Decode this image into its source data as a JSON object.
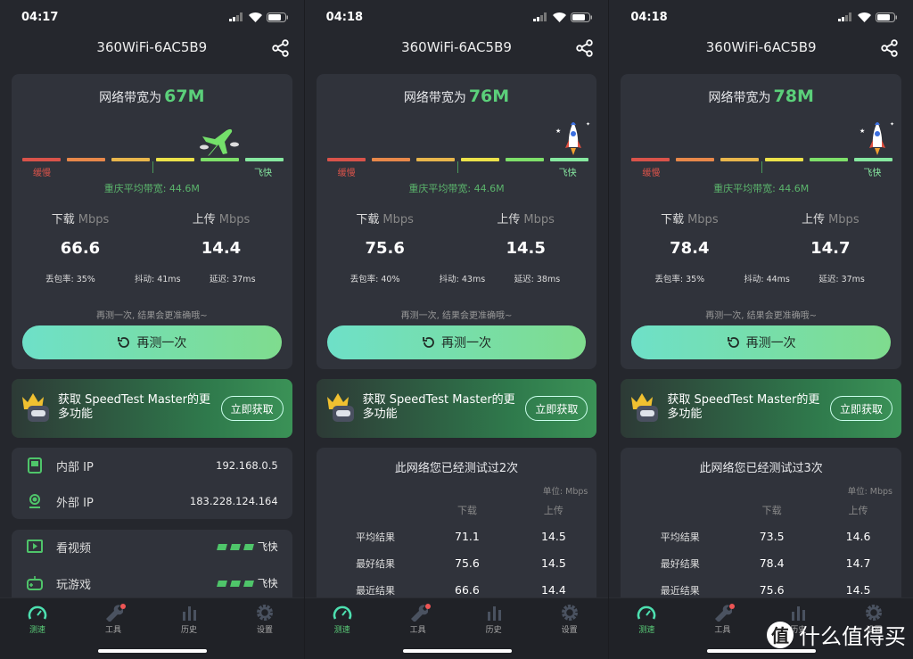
{
  "colors": {
    "accent": "#5bd07a",
    "segments": [
      "#d9534a",
      "#e8884a",
      "#e8b64c",
      "#ece24a",
      "#7ee06a",
      "#86e8a0"
    ]
  },
  "phones": [
    {
      "time": "04:17",
      "title": "360WiFi-6AC5B9",
      "bandwidth_label": "网络带宽为",
      "bandwidth": "67M",
      "gauge_icon": "airplane-icon",
      "gauge_segment": 5,
      "slow": "缓慢",
      "fast": "飞快",
      "avg": "重庆平均带宽: 44.6M",
      "download_label": "下载",
      "upload_label": "上传",
      "unit": "Mbps",
      "download": "66.6",
      "upload": "14.4",
      "loss": "丢包率: 35%",
      "jitter": "抖动: 41ms",
      "latency": "延迟: 37ms",
      "hint": "再测一次, 结果会更准确哦~",
      "retest": "再测一次",
      "promo": "获取 SpeedTest Master的更多功能",
      "promo_btn": "立即获取",
      "ip": [
        {
          "label": "内部 IP",
          "value": "192.168.0.5"
        },
        {
          "label": "外部 IP",
          "value": "183.228.124.164"
        }
      ],
      "apps": [
        {
          "label": "看视频",
          "value": "飞快",
          "level": 3
        },
        {
          "label": "玩游戏",
          "value": "飞快",
          "level": 3
        }
      ]
    },
    {
      "time": "04:18",
      "title": "360WiFi-6AC5B9",
      "bandwidth_label": "网络带宽为",
      "bandwidth": "76M",
      "gauge_icon": "rocket-icon",
      "gauge_segment": 6,
      "slow": "缓慢",
      "fast": "飞快",
      "avg": "重庆平均带宽: 44.6M",
      "download_label": "下载",
      "upload_label": "上传",
      "unit": "Mbps",
      "download": "75.6",
      "upload": "14.5",
      "loss": "丢包率: 40%",
      "jitter": "抖动: 43ms",
      "latency": "延迟: 38ms",
      "hint": "再测一次, 结果会更准确哦~",
      "retest": "再测一次",
      "promo": "获取 SpeedTest Master的更多功能",
      "promo_btn": "立即获取",
      "history": {
        "title": "此网络您已经测试过2次",
        "unit": "单位: Mbps",
        "cols": [
          "",
          "下载",
          "上传"
        ],
        "rows": [
          [
            "平均结果",
            "71.1",
            "14.5"
          ],
          [
            "最好结果",
            "75.6",
            "14.5"
          ],
          [
            "最近结果",
            "66.6",
            "14.4"
          ]
        ]
      }
    },
    {
      "time": "04:18",
      "title": "360WiFi-6AC5B9",
      "bandwidth_label": "网络带宽为",
      "bandwidth": "78M",
      "gauge_icon": "rocket-icon",
      "gauge_segment": 6,
      "slow": "缓慢",
      "fast": "飞快",
      "avg": "重庆平均带宽: 44.6M",
      "download_label": "下载",
      "upload_label": "上传",
      "unit": "Mbps",
      "download": "78.4",
      "upload": "14.7",
      "loss": "丢包率: 35%",
      "jitter": "抖动: 44ms",
      "latency": "延迟: 37ms",
      "hint": "再测一次, 结果会更准确哦~",
      "retest": "再测一次",
      "promo": "获取 SpeedTest Master的更多功能",
      "promo_btn": "立即获取",
      "history": {
        "title": "此网络您已经测试过3次",
        "unit": "单位: Mbps",
        "cols": [
          "",
          "下载",
          "上传"
        ],
        "rows": [
          [
            "平均结果",
            "73.5",
            "14.6"
          ],
          [
            "最好结果",
            "78.4",
            "14.7"
          ],
          [
            "最近结果",
            "75.6",
            "14.5"
          ]
        ]
      }
    }
  ],
  "tabs": [
    {
      "label": "测速",
      "icon": "speedometer-icon",
      "active": true
    },
    {
      "label": "工具",
      "icon": "wrench-icon",
      "badge": true
    },
    {
      "label": "历史",
      "icon": "bar-chart-icon"
    },
    {
      "label": "设置",
      "icon": "gear-icon"
    }
  ],
  "watermark": {
    "glyph": "值",
    "text": "什么值得买"
  }
}
